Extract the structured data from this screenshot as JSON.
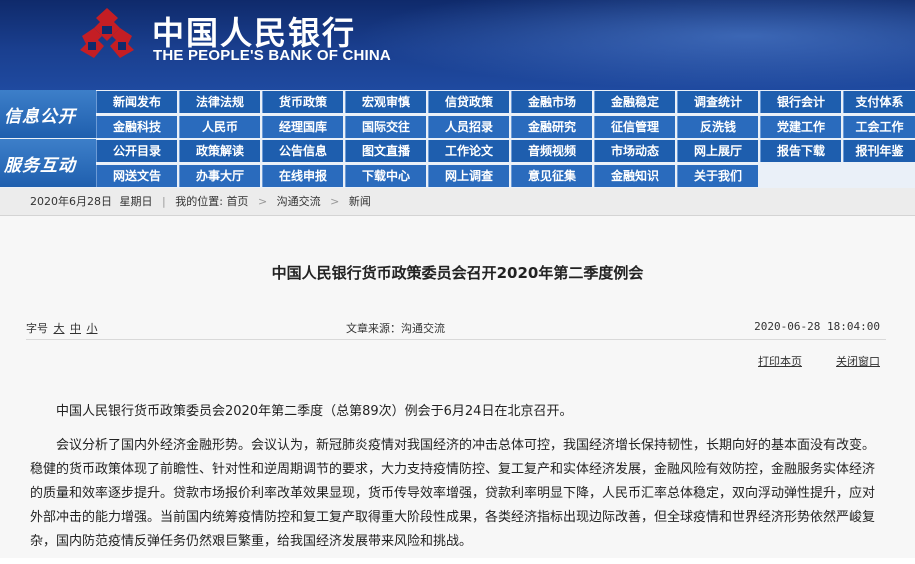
{
  "header": {
    "brand_cn": "中国人民银行",
    "brand_en": "THE PEOPLE'S BANK OF CHINA",
    "logo": "pboc-emblem",
    "colors": {
      "bg": "#1a3f8f",
      "logo_red": "#c41e24"
    }
  },
  "nav": {
    "section1": "信息公开",
    "section2": "服务互动",
    "rows": [
      [
        "新闻发布",
        "法律法规",
        "货币政策",
        "宏观审慎",
        "信贷政策",
        "金融市场",
        "金融稳定",
        "调查统计",
        "银行会计",
        "支付体系"
      ],
      [
        "金融科技",
        "人民币",
        "经理国库",
        "国际交往",
        "人员招录",
        "金融研究",
        "征信管理",
        "反洗钱",
        "党建工作",
        "工会工作"
      ],
      [
        "公开目录",
        "政策解读",
        "公告信息",
        "图文直播",
        "工作论文",
        "音频视频",
        "市场动态",
        "网上展厅",
        "报告下载",
        "报刊年鉴"
      ],
      [
        "网送文告",
        "办事大厅",
        "在线申报",
        "下载中心",
        "网上调查",
        "意见征集",
        "金融知识",
        "关于我们"
      ]
    ]
  },
  "breadcrumb": {
    "date": "2020年6月28日",
    "weekday": "星期日",
    "location_label": "我的位置:",
    "home": "首页",
    "level1": "沟通交流",
    "level2": "新闻",
    "separator": ">"
  },
  "article": {
    "title": "中国人民银行货币政策委员会召开2020年第二季度例会",
    "font_size_label": "字号",
    "font_sizes": [
      "大",
      "中",
      "小"
    ],
    "source": "文章来源：沟通交流",
    "datetime": "2020-06-28 18:04:00",
    "print_label": "打印本页",
    "close_label": "关闭窗口",
    "paragraphs": [
      "中国人民银行货币政策委员会2020年第二季度（总第89次）例会于6月24日在北京召开。",
      "会议分析了国内外经济金融形势。会议认为，新冠肺炎疫情对我国经济的冲击总体可控，我国经济增长保持韧性，长期向好的基本面没有改变。稳健的货币政策体现了前瞻性、针对性和逆周期调节的要求，大力支持疫情防控、复工复产和实体经济发展，金融风险有效防控，金融服务实体经济的质量和效率逐步提升。贷款市场报价利率改革效果显现，货币传导效率增强，贷款利率明显下降，人民币汇率总体稳定，双向浮动弹性提升，应对外部冲击的能力增强。当前国内统筹疫情防控和复工复产取得重大阶段性成果，各类经济指标出现边际改善，但全球疫情和世界经济形势依然严峻复杂，国内防范疫情反弹任务仍然艰巨繁重，给我国经济发展带来风险和挑战。"
    ]
  }
}
